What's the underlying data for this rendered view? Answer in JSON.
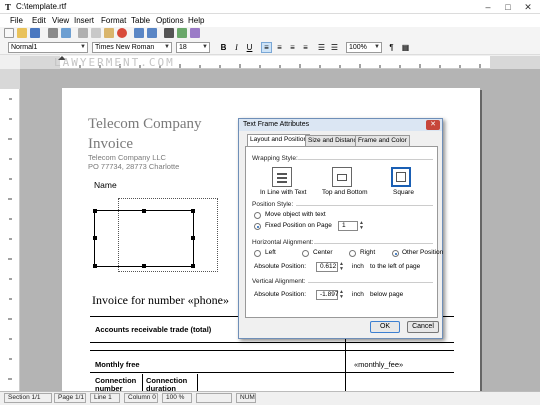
{
  "window": {
    "title": "C:\\template.rtf",
    "app_icon_glyph": "T"
  },
  "menu": [
    "File",
    "Edit",
    "View",
    "Insert",
    "Format",
    "Table",
    "Options",
    "Help"
  ],
  "toolbar": {
    "style": "Normal1",
    "font": "Times New Roman",
    "size": "18",
    "bold": "B",
    "italic": "I",
    "underline": "U",
    "zoom": "100%",
    "pilcrow": "¶"
  },
  "watermark": "LAWYERMENT.COM",
  "document": {
    "company": "Telecom Company",
    "doc_title": "Invoice",
    "company_llc": "Telecom Company LLC",
    "address": "PO 77734, 28773 Charlotte",
    "name_label": "Name",
    "invoice_heading": "Invoice for number «phone»",
    "table": {
      "accounts_label": "Accounts receivable trade (total)",
      "monthly_label": "Monthly free",
      "monthly_value": "«monthly_fee»",
      "connection_number": "Connection number",
      "connection_duration": "Connection duration"
    }
  },
  "dialog": {
    "title": "Text Frame Attributes",
    "close_glyph": "✕",
    "tabs": [
      "Layout and Position",
      "Size and Distance",
      "Frame and Color"
    ],
    "wrapping_style_label": "Wrapping Style:",
    "wrap_options": [
      "In Line with Text",
      "Top and Bottom",
      "Square"
    ],
    "position_style_label": "Position Style:",
    "position_options": [
      "Move object with text",
      "Fixed Position on Page"
    ],
    "page_number": "1",
    "horizontal_alignment_label": "Horizontal Alignment:",
    "h_options": [
      "Left",
      "Center",
      "Right",
      "Other Position"
    ],
    "absolute_position_label": "Absolute Position:",
    "h_position": "0.612",
    "h_unit_text": "inch",
    "h_relative_text": "to the left of page",
    "vertical_alignment_label": "Vertical Alignment:",
    "v_position": "-1.897",
    "v_unit_text": "inch",
    "v_relative_text": "below page",
    "ok_label": "OK",
    "cancel_label": "Cancel"
  },
  "status": {
    "section": "Section 1/1",
    "page": "Page 1/1",
    "line": "Line 1",
    "column": "Column 0",
    "zoom": "100 %",
    "num": "NUM"
  },
  "colors": {
    "accent": "#1a5fb4",
    "document_heading": "#7a7a7a",
    "workspace": "#b4b4b4"
  }
}
